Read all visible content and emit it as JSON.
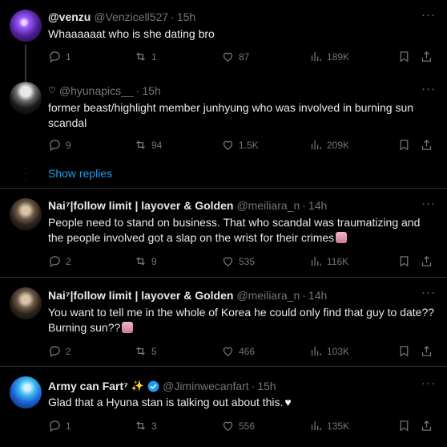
{
  "tweets": [
    {
      "name": "@venzu",
      "handle": "@Venzicell527",
      "time": "15h",
      "text": "Whaaaaaat who is she dating bro",
      "stats": {
        "replies": "1",
        "retweets": "1",
        "likes": "87",
        "views": "189K"
      }
    },
    {
      "name": "",
      "handle": "@hyunapics__",
      "time": "15h",
      "text": "former beast/highlight member junhyung who was involved in burning sun scandal",
      "stats": {
        "replies": "9",
        "retweets": "94",
        "likes": "1.5K",
        "views": "209K"
      }
    },
    {
      "name": "Nai⁷|follow limit | layover & Golden",
      "handle": "@meiliara_n",
      "time": "14h",
      "text": "People need to stand on business. That who scandal was traumatizing and the people involved got a slap on the wrist for their crimes",
      "stats": {
        "replies": "2",
        "retweets": "9",
        "likes": "535",
        "views": "116K"
      }
    },
    {
      "name": "Nai⁷|follow limit | layover & Golden",
      "handle": "@meiliara_n",
      "time": "14h",
      "text": "You want to tell me in the whole of Korea he could only find that guy to date?? Burning sun??",
      "stats": {
        "replies": "2",
        "retweets": "5",
        "likes": "466",
        "views": "103K"
      }
    },
    {
      "name": "Army can Fart⁷",
      "handle": "@Jiminwecanfart",
      "time": "15h",
      "text": "Glad that a Hyuna stan is talking out about this.",
      "stats": {
        "replies": "1",
        "retweets": "3",
        "likes": "556",
        "views": "135K"
      }
    }
  ],
  "show_replies_label": "Show replies",
  "separator": "·",
  "more_label": "···",
  "colors": {
    "background": "#000000",
    "text": "#e7e9ea",
    "muted": "#71767b",
    "link": "#1d9bf0",
    "divider": "#2f3336",
    "verified": "#1d9bf0"
  },
  "icons": [
    "reply-icon",
    "retweet-icon",
    "like-icon",
    "views-icon",
    "bookmark-icon",
    "share-icon",
    "verified-icon",
    "more-icon"
  ]
}
